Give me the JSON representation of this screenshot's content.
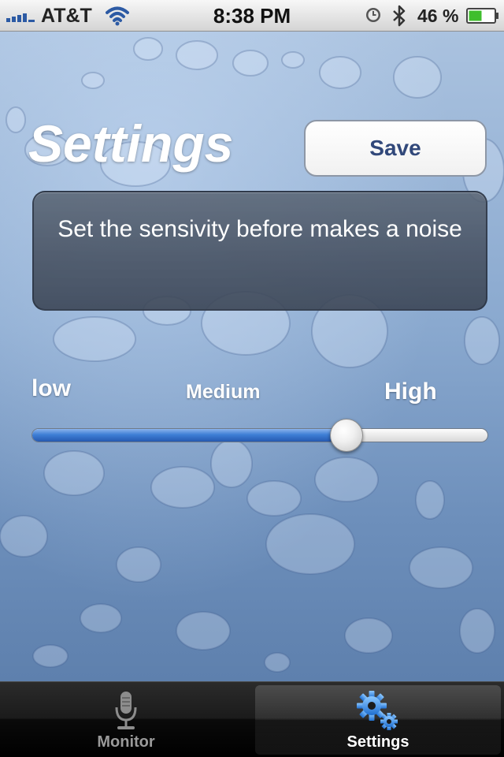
{
  "status_bar": {
    "carrier": "AT&T",
    "time": "8:38 PM",
    "battery_percent": "46 %",
    "icons": [
      "signal-icon",
      "wifi-icon",
      "alarm-icon",
      "bluetooth-icon",
      "battery-icon"
    ]
  },
  "header": {
    "title": "Settings",
    "save_label": "Save"
  },
  "info": {
    "text": "Set the sensivity before makes a noise"
  },
  "sensitivity": {
    "low_label": "low",
    "medium_label": "Medium",
    "high_label": "High",
    "value": 0.69
  },
  "tab_bar": {
    "tabs": [
      {
        "label": "Monitor",
        "icon": "microphone-icon",
        "selected": false
      },
      {
        "label": "Settings",
        "icon": "gears-icon",
        "selected": true
      }
    ]
  },
  "colors": {
    "slider_fill": "#3f7fd6",
    "save_text": "#31487a",
    "selected_tab_text": "#ffffff",
    "unselected_tab_text": "#9a9a9a"
  }
}
